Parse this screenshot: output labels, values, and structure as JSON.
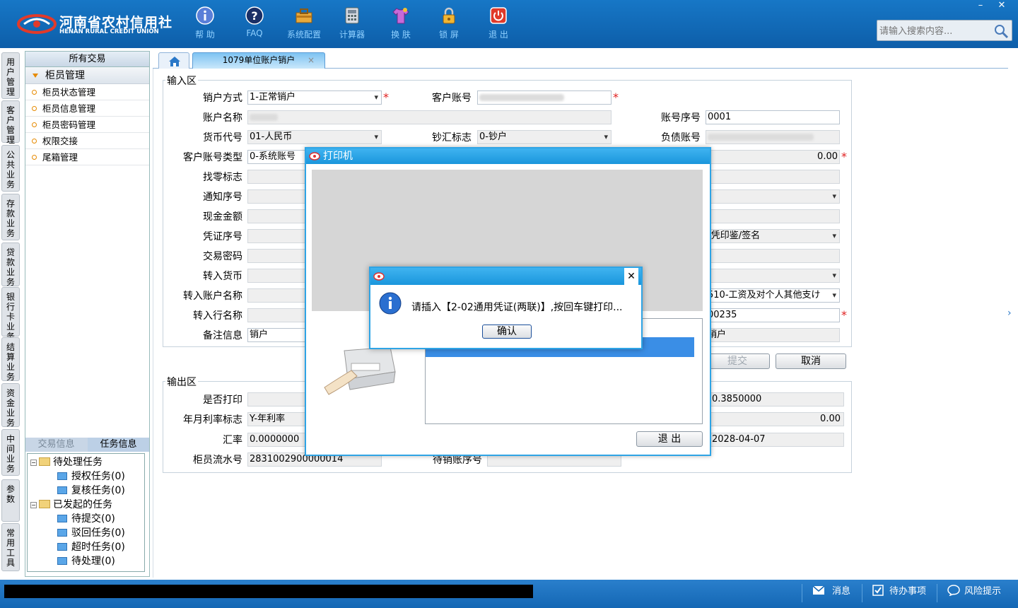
{
  "app": {
    "brand_cn": "河南省农村信用社",
    "brand_en": "HENAN RURAL CREDIT UNION"
  },
  "toolbar": [
    {
      "label": "帮 助",
      "icon": "info-icon"
    },
    {
      "label": "FAQ",
      "icon": "question-icon"
    },
    {
      "label": "系统配置",
      "icon": "toolbox-icon"
    },
    {
      "label": "计算器",
      "icon": "calculator-icon"
    },
    {
      "label": "换 肤",
      "icon": "shirt-icon"
    },
    {
      "label": "锁 屏",
      "icon": "lock-icon"
    },
    {
      "label": "退 出",
      "icon": "power-icon"
    }
  ],
  "window": {
    "minimize": "–",
    "close": "✕"
  },
  "search": {
    "placeholder": "请输入搜索内容..."
  },
  "vnav": [
    "用户管理",
    "客户管理",
    "公共业务",
    "存款业务",
    "贷款业务",
    "银行卡业务",
    "结算业务",
    "资金业务",
    "中间业务",
    "参数",
    "常用工具"
  ],
  "leftpanel": {
    "header": "所有交易",
    "group": "柜员管理",
    "items": [
      "柜员状态管理",
      "柜员信息管理",
      "柜员密码管理",
      "权限交接",
      "尾箱管理"
    ],
    "tabs": [
      "交易信息",
      "任务信息"
    ],
    "tree": {
      "pending": "待处理任务",
      "pending_children": [
        "授权任务(0)",
        "复核任务(0)"
      ],
      "started": "已发起的任务",
      "started_children": [
        "待提交(0)",
        "驳回任务(0)",
        "超时任务(0)",
        "待处理(0)"
      ]
    }
  },
  "tabs": {
    "active": "1079单位账户销户",
    "close": "×"
  },
  "form": {
    "input_section": "输入区",
    "output_section": "输出区",
    "labels": {
      "cancel_method": "销户方式",
      "customer_account": "客户账号",
      "account_name": "账户名称",
      "account_seq": "账号序号",
      "currency": "货币代号",
      "cash_flag": "钞汇标志",
      "liability_account": "负债账号",
      "account_type": "客户账号类型",
      "change_flag": "找零标志",
      "notice_no": "通知序号",
      "cash_amount": "现金金额",
      "voucher_no": "凭证序号",
      "trade_pwd": "交易密码",
      "transfer_currency": "转入货币",
      "transfer_account_name": "转入账户名称",
      "transfer_bank_name": "转入行名称",
      "remark": "备注信息",
      "print_flag": "是否打印",
      "rate_flag": "年月利率标志",
      "exchange_rate": "汇率",
      "teller_serial": "柜员流水号",
      "pending_account": "待销账序号"
    },
    "values": {
      "cancel_method": "1-正常销户",
      "account_seq": "0001",
      "currency": "01-人民币",
      "cash_flag": "0-钞户",
      "account_type": "0-系统账号",
      "amount": "0.00",
      "verify_method": "-凭印鉴/签名",
      "purpose": "510-工资及对个人其他支け",
      "bank_code": "00235",
      "remark": "销户",
      "remark_right": "销户",
      "rate_flag": "Y-年利率",
      "exchange_rate": "0.0000000",
      "teller_serial": "2831002900000014",
      "interest_rate": "0.3850000",
      "interest": "0.00",
      "date": "2028-04-07"
    },
    "buttons": {
      "submit": "提交",
      "cancel": "取消"
    }
  },
  "print_dialog": {
    "title": "打印机",
    "exit": "退  出"
  },
  "message": {
    "text": "请插入【2-02通用凭证(两联)】,按回车键打印...",
    "ok": "确认",
    "close": "✕"
  },
  "statusbar": {
    "messages": "消息",
    "todo": "待办事项",
    "risk": "风险提示"
  },
  "colors": {
    "header": "#1777c6",
    "dialog_border": "#2ea4e5",
    "required": "#e02020",
    "toolbar_text": "#8fd0ff"
  }
}
